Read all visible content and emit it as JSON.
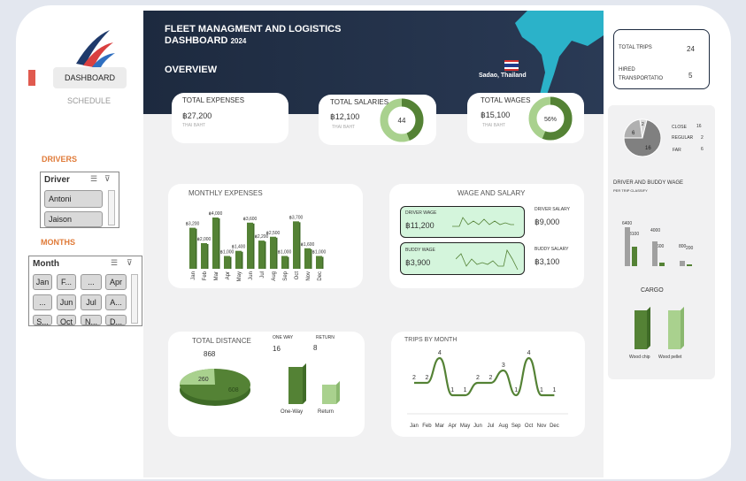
{
  "nav": {
    "dashboard": "DASHBOARD",
    "schedule": "SCHEDULE",
    "drivers": "DRIVERS",
    "months": "MONTHS"
  },
  "driver_slicer": {
    "title": "Driver",
    "items": [
      "Antoni",
      "Jaison"
    ]
  },
  "month_slicer": {
    "title": "Month",
    "items": [
      "Jan",
      "F...",
      "...",
      "Apr",
      "...",
      "Jun",
      "Jul",
      "A...",
      "S...",
      "Oct",
      "N...",
      "D..."
    ]
  },
  "header": {
    "title_line1": "FLEET MANAGMENT AND LOGISTICS",
    "title_line2": "DASHBOARD",
    "year": "2024",
    "overview": "OVERVIEW",
    "location": "Sadao, Thailand"
  },
  "kpis": {
    "expenses": {
      "label": "TOTAL EXPENSES",
      "value": "฿27,200",
      "unit": "THAI BAHT"
    },
    "salaries": {
      "label": "TOTAL SALARIES",
      "value": "฿12,100",
      "unit": "THAI BAHT",
      "donut": "44",
      "fraction": 0.44
    },
    "wages": {
      "label": "TOTAL WAGES",
      "value": "฿15,100",
      "unit": "THAI BAHT",
      "donut": "56%",
      "fraction": 0.56
    }
  },
  "monthly": {
    "title": "MONTHLY EXPENSES",
    "months": [
      "Jan",
      "Feb",
      "Mar",
      "Apr",
      "May",
      "Jun",
      "Jul",
      "Aug",
      "Sep",
      "Oct",
      "Nov",
      "Dec"
    ],
    "values": [
      3200,
      2000,
      4000,
      1000,
      1400,
      3600,
      2200,
      2500,
      1000,
      3700,
      1600,
      1000
    ],
    "labels": [
      "฿3,200",
      "฿2,000",
      "฿4,000",
      "฿1,000",
      "฿1,400",
      "฿3,600",
      "฿2,200",
      "฿2,500",
      "฿1,000",
      "฿3,700",
      "฿1,600",
      "฿1,000"
    ]
  },
  "wage_salary": {
    "title": "WAGE AND SALARY",
    "driver_wage_label": "DRIVER WAGE",
    "driver_wage": "฿11,200",
    "buddy_wage_label": "BUDDY WAGE",
    "buddy_wage": "฿3,900",
    "driver_salary_label": "DRIVER SALARY",
    "driver_salary": "฿9,000",
    "buddy_salary_label": "BUDDY SALARY",
    "buddy_salary": "฿3,100"
  },
  "distance": {
    "title": "TOTAL DISTANCE",
    "total": "868",
    "pie_small": "260",
    "pie_large": "608",
    "oneway_label": "ONE WAY",
    "oneway": "16",
    "return_label": "RETURN",
    "return": "8",
    "bar1": "One-Way",
    "bar2": "Return"
  },
  "trips": {
    "title": "TRIPS BY MONTH",
    "months": [
      "Jan",
      "Feb",
      "Mar",
      "Apr",
      "May",
      "Jun",
      "Jul",
      "Aug",
      "Sep",
      "Oct",
      "Nov",
      "Dec"
    ],
    "values": [
      2,
      2,
      4,
      1,
      1,
      2,
      2,
      3,
      1,
      4,
      1,
      1
    ]
  },
  "right": {
    "total_trips_label": "TOTAL TRIPS",
    "total_trips": "24",
    "hired_label": "HIRED TRANSPORTATIO",
    "hired": "5",
    "classify": [
      {
        "label": "CLOSE",
        "value": "16"
      },
      {
        "label": "REGULAR",
        "value": "2"
      },
      {
        "label": "FAR",
        "value": "6"
      }
    ],
    "pie_labels": [
      "2",
      "6",
      "16"
    ],
    "wage_title": "DRIVER AND BUDDY WAGE",
    "wage_sub": "PER TRIP CLASSIFY",
    "wage_labels": [
      "6400",
      "3100",
      "4000",
      "600",
      "800",
      "200"
    ],
    "cargo_title": "CARGO",
    "cargo1": "Wood chip",
    "cargo2": "Wood pellet"
  },
  "colors": {
    "dark_green": "#548235",
    "light_green": "#a9d18e",
    "orange": "#e07b39",
    "navy": "#1d2a3f"
  }
}
